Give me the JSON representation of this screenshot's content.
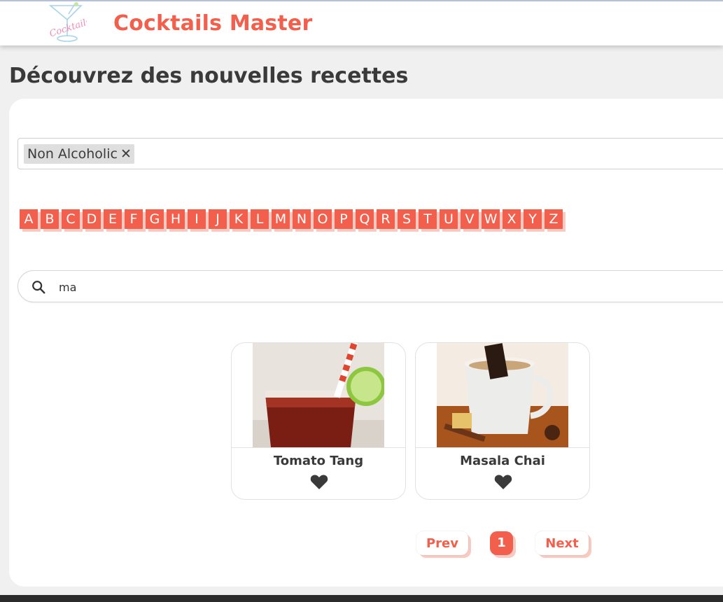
{
  "header": {
    "app_title": "Cocktails Master",
    "logo_text": "Cocktails",
    "logo_icon": "cocktail-glass-icon"
  },
  "main": {
    "heading": "Découvrez des nouvelles recettes"
  },
  "filters": {
    "tags": [
      {
        "label": "Non Alcoholic",
        "remove_icon": "close-icon",
        "remove_glyph": "✕"
      }
    ]
  },
  "alphabet": [
    "A",
    "B",
    "C",
    "D",
    "E",
    "F",
    "G",
    "H",
    "I",
    "J",
    "K",
    "L",
    "M",
    "N",
    "O",
    "P",
    "Q",
    "R",
    "S",
    "T",
    "U",
    "V",
    "W",
    "X",
    "Y",
    "Z"
  ],
  "search": {
    "icon": "search-icon",
    "value": "ma"
  },
  "results": [
    {
      "title": "Tomato Tang",
      "icon": "heart-icon"
    },
    {
      "title": "Masala Chai",
      "icon": "heart-icon"
    }
  ],
  "pagination": {
    "prev_label": "Prev",
    "current_page": "1",
    "next_label": "Next"
  },
  "colors": {
    "accent": "#f25f4c",
    "accent_shadow": "#f9c9c2",
    "background": "#f0f0f0",
    "text": "#3a3a3a"
  }
}
